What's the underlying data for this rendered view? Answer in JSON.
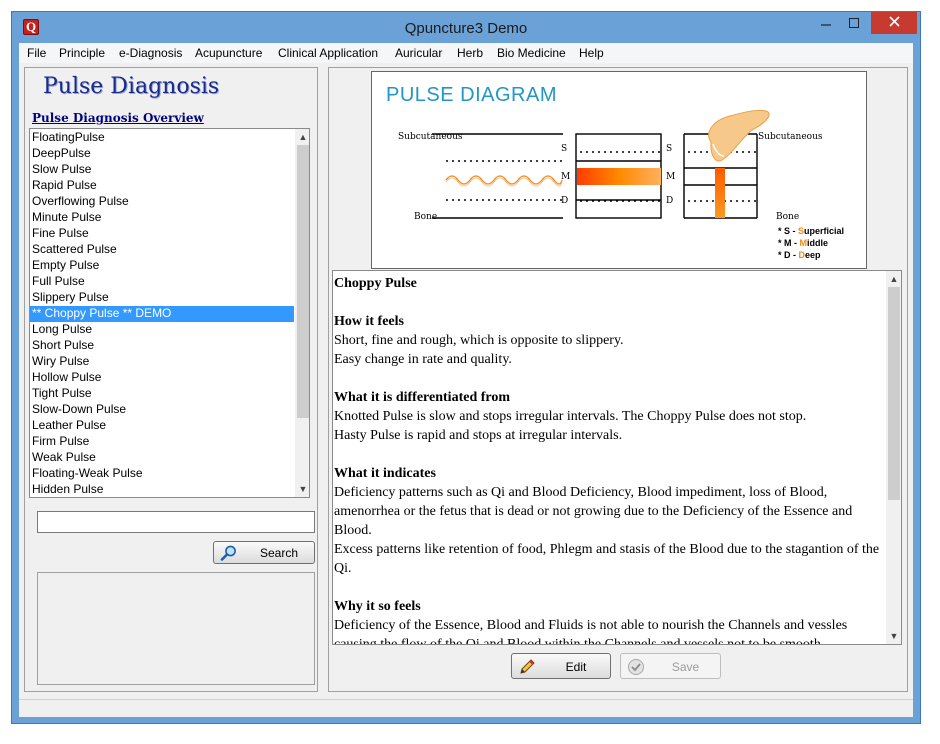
{
  "window": {
    "title": "Qpuncture3 Demo",
    "icon_letter": "Q"
  },
  "menu": [
    "File",
    "Principle",
    "e-Diagnosis",
    "Acupuncture",
    "Clinical Application",
    "Auricular",
    "Herb",
    "Bio Medicine",
    "Help"
  ],
  "left": {
    "logo": "Pulse Diagnosis",
    "overview_link": "Pulse Diagnosis Overview",
    "pulse_list": [
      "FloatingPulse",
      "DeepPulse",
      "Slow Pulse",
      "Rapid Pulse",
      "Overflowing Pulse",
      "Minute Pulse",
      "Fine Pulse",
      "Scattered Pulse",
      "Empty Pulse",
      "Full Pulse",
      "Slippery Pulse",
      "** Choppy Pulse ** DEMO",
      "Long Pulse",
      "Short Pulse",
      "Wiry Pulse",
      "Hollow Pulse",
      "Tight Pulse",
      "Slow-Down Pulse",
      "Leather Pulse",
      "Firm Pulse",
      "Weak Pulse",
      "Floating-Weak Pulse",
      "Hidden Pulse"
    ],
    "selected_index": 11,
    "search_value": "",
    "search_label": "Search"
  },
  "diagram": {
    "title": "PULSE DIAGRAM",
    "subcutaneous": "Subcutaneous",
    "bone": "Bone",
    "s": "S",
    "m": "M",
    "d": "D",
    "legend": [
      {
        "prefix": "* S - ",
        "highlight": "S",
        "rest": "uperficial"
      },
      {
        "prefix": "* M - ",
        "highlight": "M",
        "rest": "iddle"
      },
      {
        "prefix": "* D - ",
        "highlight": "D",
        "rest": "eep"
      }
    ],
    "colors": {
      "title": "#2196c9",
      "fill": "#ff6a00",
      "accent": "#f08a1b"
    }
  },
  "content": {
    "title": "Choppy Pulse",
    "sections": [
      {
        "heading": "How it feels",
        "lines": [
          "Short, fine and rough, which is opposite to slippery.",
          "Easy change in rate and quality."
        ]
      },
      {
        "heading": "What it is differentiated from",
        "lines": [
          "Knotted Pulse is slow and stops irregular intervals. The Choppy Pulse does not stop.",
          "Hasty Pulse is rapid and stops at irregular intervals."
        ]
      },
      {
        "heading": "What it indicates",
        "lines": [
          "Deficiency patterns such as Qi and Blood Deficiency, Blood impediment, loss of Blood, amenorrhea or the fetus that is dead or not growing due to the Deficiency of the Essence and Blood.",
          "Excess patterns like retention of food, Phlegm and stasis of the Blood due to the stagantion of the Qi."
        ]
      },
      {
        "heading": "Why it so feels",
        "lines": [
          "Deficiency of the Essence, Blood and Fluids is not able to nourish the Channels and vessles causing the flow of the Qi and Blood within the Channels and vessels not to be smooth."
        ]
      }
    ]
  },
  "buttons": {
    "edit": "Edit",
    "save": "Save"
  }
}
